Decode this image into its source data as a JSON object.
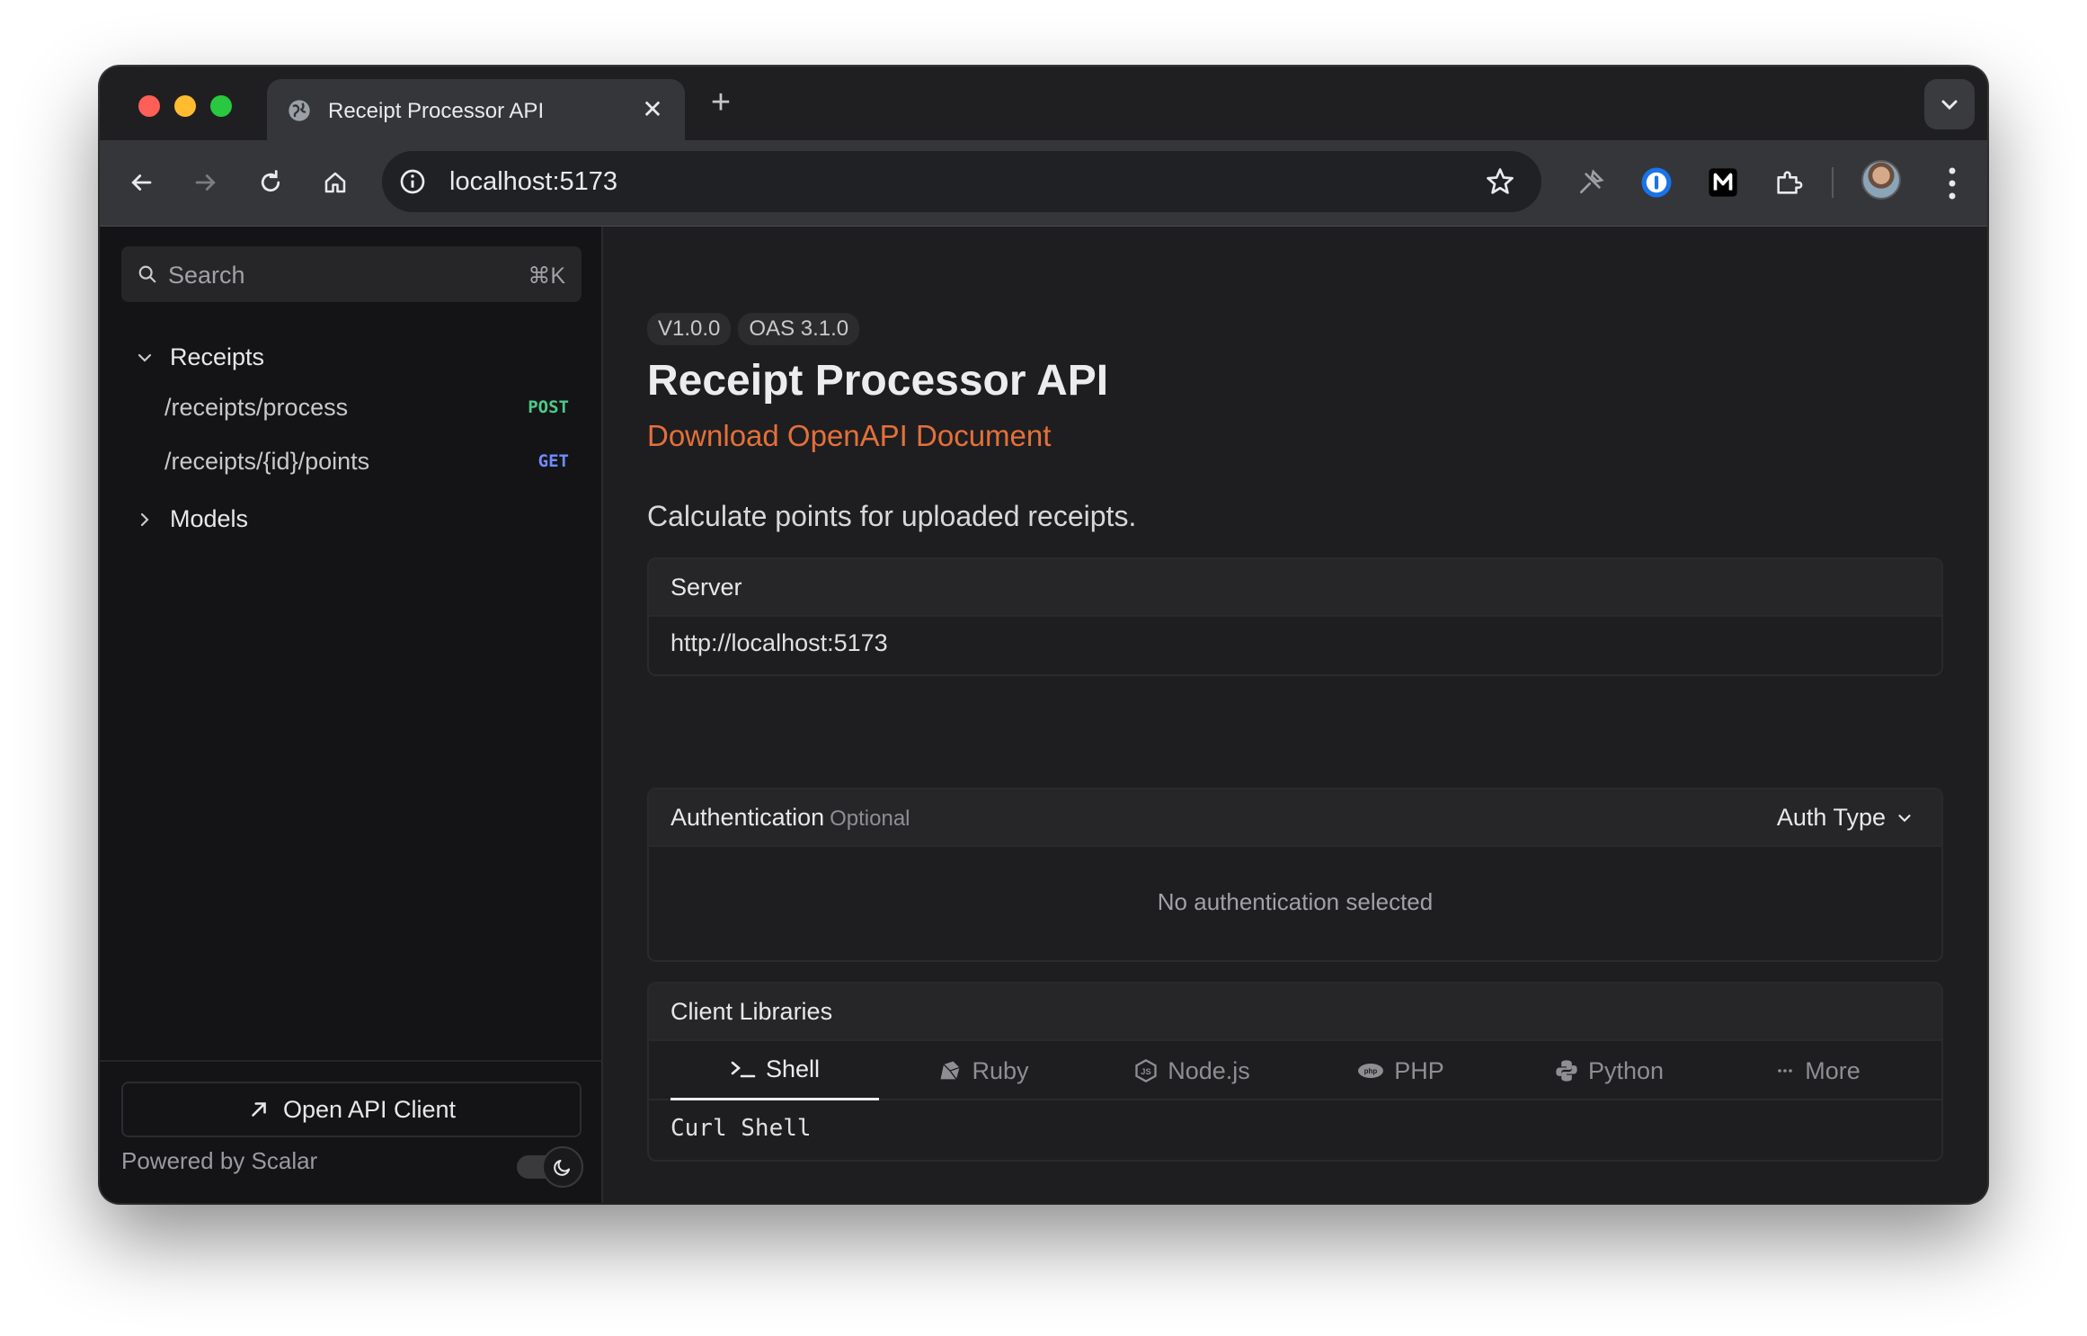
{
  "browser": {
    "tab_title": "Receipt Processor API",
    "url": "localhost:5173",
    "tab_close_glyph": "✕",
    "new_tab_glyph": "+"
  },
  "sidebar": {
    "search_placeholder": "Search",
    "search_shortcut": "⌘K",
    "groups": [
      {
        "label": "Receipts",
        "expanded": true,
        "items": [
          {
            "path": "/receipts/process",
            "method": "POST"
          },
          {
            "path": "/receipts/{id}/points",
            "method": "GET"
          }
        ]
      },
      {
        "label": "Models",
        "expanded": false
      }
    ],
    "open_client_label": "Open API Client",
    "powered_by": "Powered by Scalar"
  },
  "main": {
    "version_badge": "V1.0.0",
    "oas_badge": "OAS 3.1.0",
    "title": "Receipt Processor API",
    "download_link": "Download OpenAPI Document",
    "description": "Calculate points for uploaded receipts.",
    "server": {
      "label": "Server",
      "url": "http://localhost:5173"
    },
    "auth": {
      "label": "Authentication",
      "optional": "Optional",
      "auth_type": "Auth Type",
      "empty": "No authentication selected"
    },
    "client_libraries": {
      "label": "Client Libraries",
      "tabs": [
        "Shell",
        "Ruby",
        "Node.js",
        "PHP",
        "Python",
        "More"
      ],
      "active_tab": "Shell",
      "selected_client": "Curl Shell"
    }
  },
  "colors": {
    "accent_link": "#e4703a",
    "post": "#4ec98a",
    "get": "#6f8cff"
  }
}
